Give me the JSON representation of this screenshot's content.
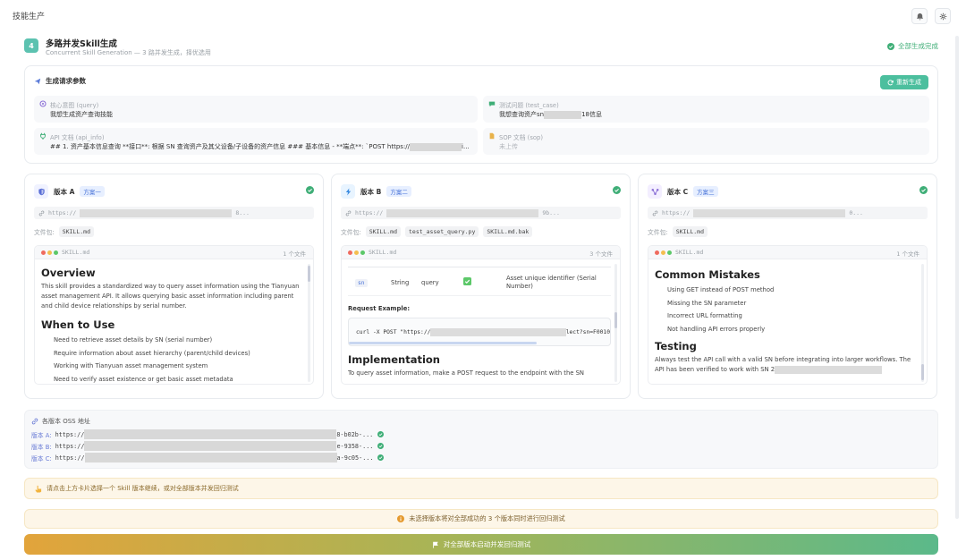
{
  "app": {
    "title": "技能生产"
  },
  "step": {
    "number": "4",
    "title": "多路并发Skill生成",
    "subtitle": "Concurrent Skill Generation — 3 路并发生成，择优选用",
    "status": "全部生成完成"
  },
  "request": {
    "title": "生成请求参数",
    "regen_label": "重新生成",
    "params": {
      "query": {
        "label": "核心意图 (query)",
        "value": "我想生成资产查询技能"
      },
      "test_case": {
        "label": "测试问题 (test_case)",
        "value_prefix": "我想查询资产sn",
        "value_suffix": "18信息"
      },
      "api_info": {
        "label": "API 文档 (api_info)",
        "value_prefix": "## 1. 资产基本信息查询 **接口**: 根据 SN 查询资产及其父设备/子设备的资产信息 ### 基本信息 - **端点**: `POST https://",
        "value_suffix": "i..."
      },
      "sop": {
        "label": "SOP 文档 (sop)",
        "value": "未上传"
      }
    },
    "colors": {
      "accent": "#4cbf9e"
    }
  },
  "versions": [
    {
      "name": "版本 A",
      "tag": "方案一",
      "icon": "shield-icon",
      "url_prefix": "https://",
      "url_suffix": "8...",
      "files_label": "文件包:",
      "files": [
        "SKILL.md"
      ],
      "preview_file": "SKILL.md",
      "file_count": "1 个文件",
      "overview_heading": "Overview",
      "overview_text": "This skill provides a standardized way to query asset information using the Tianyuan asset management API. It allows querying basic asset information including parent and child device relationships by serial number.",
      "when_heading": "When to Use",
      "when_items": [
        "Need to retrieve asset details by SN (serial number)",
        "Require information about asset hierarchy (parent/child devices)",
        "Working with Tianyuan asset management system",
        "Need to verify asset existence or get basic asset metadata"
      ]
    },
    {
      "name": "版本 B",
      "tag": "方案二",
      "icon": "lightning-icon",
      "url_prefix": "https://",
      "url_suffix": "9b...",
      "files_label": "文件包:",
      "files": [
        "SKILL.md",
        "test_asset_query.py",
        "SKILL.md.bak"
      ],
      "preview_file": "SKILL.md",
      "file_count": "3 个文件",
      "param_row": {
        "name": "sn",
        "type": "String",
        "location": "query",
        "desc": "Asset unique identifier (Serial Number)"
      },
      "request_example_label": "Request Example:",
      "code_prefix": "curl -X POST \"https://",
      "code_suffix": "lect?sn=F0010",
      "impl_heading": "Implementation",
      "impl_text": "To query asset information, make a POST request to the endpoint with the SN"
    },
    {
      "name": "版本 C",
      "tag": "方案三",
      "icon": "network-icon",
      "url_prefix": "https://",
      "url_suffix": "0...",
      "files_label": "文件包:",
      "files": [
        "SKILL.md"
      ],
      "preview_file": "SKILL.md",
      "file_count": "1 个文件",
      "mistakes_heading": "Common Mistakes",
      "mistakes_items": [
        "Using GET instead of POST method",
        "Missing the SN parameter",
        "Incorrect URL formatting",
        "Not handling API errors properly"
      ],
      "testing_heading": "Testing",
      "testing_text": "Always test the API call with a valid SN before integrating into larger workflows. The API has been verified to work with SN 2"
    }
  ],
  "oss": {
    "title": "各版本 OSS 地址",
    "rows": [
      {
        "label": "版本 A:",
        "prefix": "https://",
        "suffix": "8-b02b-..."
      },
      {
        "label": "版本 B:",
        "prefix": "https://",
        "suffix": "e-9358-..."
      },
      {
        "label": "版本 C:",
        "prefix": "https://",
        "suffix": "a-9c05-..."
      }
    ]
  },
  "tip": "请点击上方卡片选择一个 Skill 版本继续，或对全部版本并发回归测试",
  "notice": "未选择版本将对全部成功的 3 个版本同时进行回归测试",
  "launch_label": "对全部版本启动并发回归测试"
}
